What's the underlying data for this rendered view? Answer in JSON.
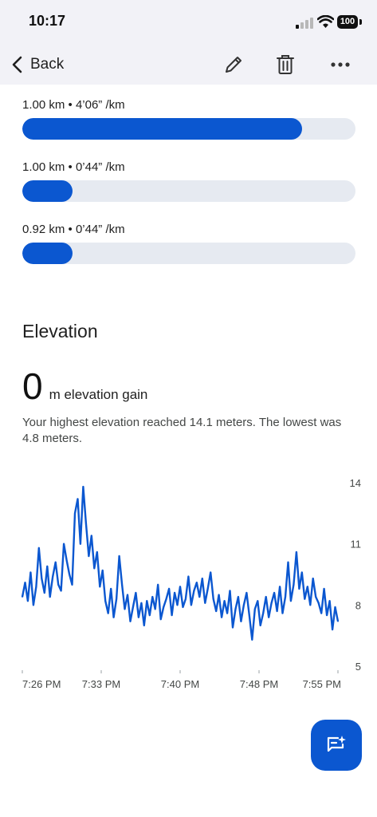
{
  "status_bar": {
    "time": "10:17",
    "battery": "100"
  },
  "header": {
    "back_label": "Back",
    "icons": [
      "edit-icon",
      "trash-icon",
      "more-icon"
    ]
  },
  "splits": [
    {
      "label": "1.00 km • 4’06” /km",
      "progress": 0.84
    },
    {
      "label": "1.00 km • 0’44” /km",
      "progress": 0.15
    },
    {
      "label": "0.92 km • 0’44” /km",
      "progress": 0.15
    }
  ],
  "elevation": {
    "title": "Elevation",
    "gain_value": "0",
    "gain_unit": "m elevation gain",
    "summary": "Your highest elevation reached 14.1 meters. The lowest was 4.8 meters."
  },
  "chart_data": {
    "type": "line",
    "title": "",
    "xlabel": "",
    "ylabel": "",
    "ylim": [
      5,
      14
    ],
    "y_ticks": [
      "14",
      "11",
      "8",
      "5"
    ],
    "x_ticks": [
      "7:26 PM",
      "7:33 PM",
      "7:40 PM",
      "7:48 PM",
      "7:55 PM"
    ],
    "grid": false,
    "color": "#0b57d0",
    "series": [
      {
        "values": [
          8.4,
          9.1,
          8.2,
          9.6,
          8.0,
          8.9,
          10.8,
          9.3,
          8.6,
          9.9,
          8.4,
          9.4,
          10.1,
          9.0,
          8.7,
          11.0,
          10.2,
          9.5,
          9.0,
          12.5,
          13.2,
          11.0,
          13.8,
          12.0,
          10.4,
          11.4,
          9.8,
          10.6,
          8.9,
          9.7,
          8.2,
          7.6,
          8.8,
          7.4,
          8.3,
          10.4,
          9.0,
          7.8,
          8.5,
          7.2,
          7.9,
          8.6,
          7.4,
          8.1,
          7.0,
          8.2,
          7.5,
          8.4,
          7.8,
          9.0,
          7.3,
          7.9,
          8.3,
          8.8,
          7.5,
          8.6,
          8.0,
          8.9,
          7.9,
          8.3,
          9.4,
          8.0,
          8.7,
          9.1,
          8.4,
          9.3,
          8.1,
          8.8,
          9.6,
          8.3,
          7.7,
          8.5,
          7.4,
          8.2,
          7.6,
          8.7,
          6.9,
          7.8,
          8.4,
          7.2,
          8.0,
          8.6,
          7.5,
          6.3,
          7.8,
          8.2,
          7.0,
          7.6,
          8.4,
          7.4,
          8.1,
          8.6,
          7.7,
          8.9,
          7.6,
          8.4,
          10.1,
          8.2,
          9.0,
          10.6,
          8.8,
          9.6,
          8.3,
          8.9,
          8.0,
          9.3,
          8.4,
          8.1,
          7.6,
          8.8,
          7.5,
          8.2,
          6.8,
          7.9,
          7.2
        ]
      }
    ]
  },
  "fab": {
    "icon": "ai-chat-icon"
  }
}
